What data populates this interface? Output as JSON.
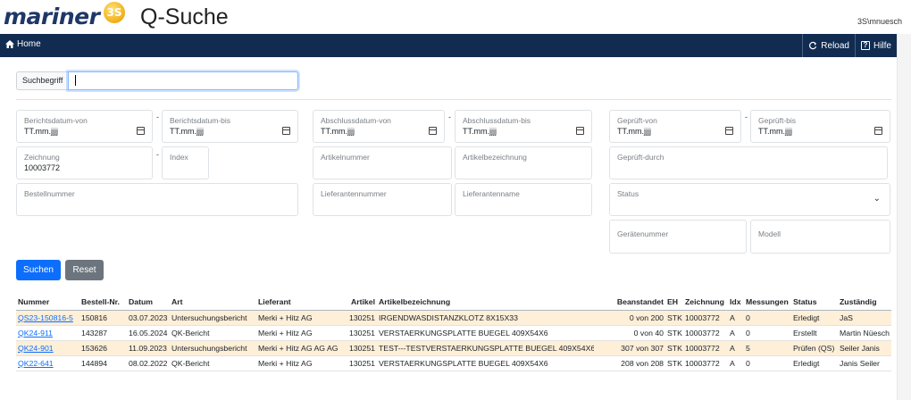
{
  "header": {
    "logo_text": "mariner",
    "logo_badge": "3S",
    "app_title": "Q-Suche",
    "user": "3S\\mnuesch"
  },
  "nav": {
    "home": "Home",
    "reload": "Reload",
    "help": "Hilfe"
  },
  "search": {
    "label": "Suchbegriff",
    "value": ""
  },
  "filters": {
    "berichtsdatum_von": {
      "label": "Berichtsdatum-von",
      "value": "TT.mm.jjjj"
    },
    "berichtsdatum_bis": {
      "label": "Berichtsdatum-bis",
      "value": "TT.mm.jjjj"
    },
    "abschlussdatum_von": {
      "label": "Abschlussdatum-von",
      "value": "TT.mm.jjjj"
    },
    "abschlussdatum_bis": {
      "label": "Abschlussdatum-bis",
      "value": "TT.mm.jjjj"
    },
    "geprueft_von": {
      "label": "Geprüft-von",
      "value": "TT.mm.jjjj"
    },
    "geprueft_bis": {
      "label": "Geprüft-bis",
      "value": "TT.mm.jjjj"
    },
    "zeichnung": {
      "label": "Zeichnung",
      "value": "10003772"
    },
    "index": {
      "label": "Index",
      "value": ""
    },
    "artikelnummer": {
      "label": "Artikelnummer",
      "value": ""
    },
    "artikelbezeichnung": {
      "label": "Artikelbezeichnung",
      "value": ""
    },
    "geprueft_durch": {
      "label": "Geprüft-durch",
      "value": ""
    },
    "bestellnummer": {
      "label": "Bestellnummer",
      "value": ""
    },
    "lieferantennummer": {
      "label": "Lieferantennummer",
      "value": ""
    },
    "lieferantenname": {
      "label": "Lieferantenname",
      "value": ""
    },
    "status": {
      "label": "Status",
      "value": ""
    },
    "geraetenummer": {
      "label": "Gerätenummer",
      "value": ""
    },
    "modell": {
      "label": "Modell",
      "value": ""
    },
    "dash": "-"
  },
  "buttons": {
    "suchen": "Suchen",
    "reset": "Reset"
  },
  "table": {
    "columns": [
      "Nummer",
      "Bestell-Nr.",
      "Datum",
      "Art",
      "Lieferant",
      "Artikel",
      "Artikelbezeichnung",
      "Beanstandet",
      "EH",
      "Zeichnung",
      "Idx",
      "Messungen",
      "Status",
      "Zuständig"
    ],
    "rows": [
      {
        "nummer": "QS23-150816-5",
        "bestell_nr": "150816",
        "datum": "03.07.2023",
        "art": "Untersuchungsbericht",
        "lieferant": "Merki + Hitz AG",
        "artikel": "130251",
        "artikelbezeichnung": "IRGENDWASDISTANZKLOTZ 8X15X33",
        "beanstandet": "0 von 200",
        "eh": "STK",
        "zeichnung": "10003772",
        "idx": "A",
        "messungen": "0",
        "status": "Erledigt",
        "zustaendig": "JaS"
      },
      {
        "nummer": "QK24-911",
        "bestell_nr": "143287",
        "datum": "16.05.2024",
        "art": "QK-Bericht",
        "lieferant": "Merki + Hitz AG",
        "artikel": "130251",
        "artikelbezeichnung": "VERSTAERKUNGSPLATTE BUEGEL 409X54X6",
        "beanstandet": "0 von 40",
        "eh": "STK",
        "zeichnung": "10003772",
        "idx": "A",
        "messungen": "0",
        "status": "Erstellt",
        "zustaendig": "Martin Nüesch"
      },
      {
        "nummer": "QK24-901",
        "bestell_nr": "153626",
        "datum": "11.09.2023",
        "art": "Untersuchungsbericht",
        "lieferant": "Merki + Hitz AG AG AG",
        "artikel": "130251",
        "artikelbezeichnung": "TEST---TESTVERSTAERKUNGSPLATTE BUEGEL 409X54X6",
        "beanstandet": "307 von 307",
        "eh": "STK",
        "zeichnung": "10003772",
        "idx": "A",
        "messungen": "5",
        "status": "Prüfen (QS)",
        "zustaendig": "Seiler Janis"
      },
      {
        "nummer": "QK22-641",
        "bestell_nr": "144894",
        "datum": "08.02.2022",
        "art": "QK-Bericht",
        "lieferant": "Merki + Hitz AG",
        "artikel": "130251",
        "artikelbezeichnung": "VERSTAERKUNGSPLATTE BUEGEL 409X54X6",
        "beanstandet": "208 von 208",
        "eh": "STK",
        "zeichnung": "10003772",
        "idx": "A",
        "messungen": "0",
        "status": "Erledigt",
        "zustaendig": "Janis Seiler"
      }
    ]
  },
  "colors": {
    "navbar": "#112c50",
    "primary": "#0d6efd",
    "secondary": "#6c757d",
    "row_highlight": "#fdefd8",
    "logo": "#1f3767"
  }
}
